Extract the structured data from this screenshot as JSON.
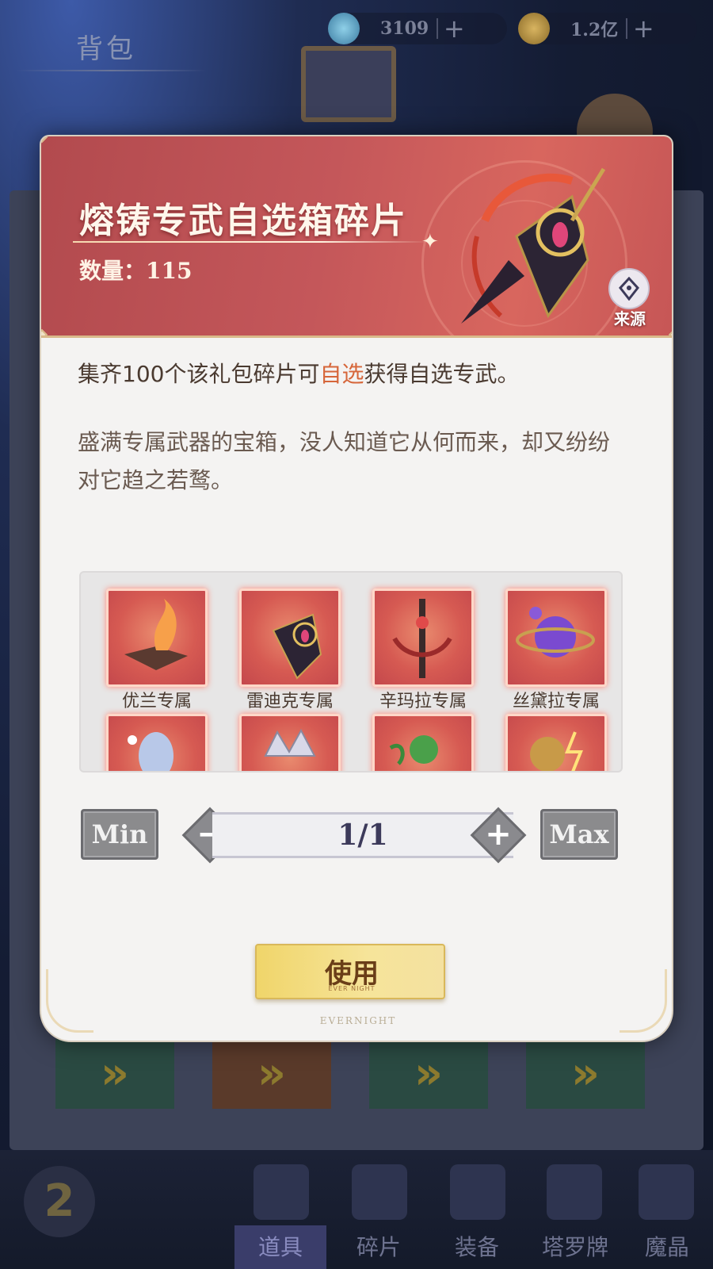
{
  "background": {
    "screen_title": "背包",
    "resources": [
      {
        "icon": "gem-icon",
        "value": "3109",
        "plus": "+"
      },
      {
        "icon": "gold-coin-icon",
        "value": "1.2亿",
        "plus": "+"
      }
    ],
    "nav_tabs": [
      {
        "label": "道具",
        "active": true
      },
      {
        "label": "碎片",
        "active": false
      },
      {
        "label": "装备",
        "active": false
      },
      {
        "label": "塔罗牌",
        "active": false
      },
      {
        "label": "魔晶",
        "active": false
      }
    ]
  },
  "item": {
    "title": "熔铸专武自选箱碎片",
    "quantity_label": "数量：",
    "quantity_value": "115",
    "source_label": "来源",
    "desc_prefix": "集齐100个该礼包碎片可",
    "desc_highlight": "自选",
    "desc_suffix": "获得自选专武。",
    "flavor_text": "盛满专属武器的宝箱，没人知道它从何而来，却又纷纷对它趋之若鹜。"
  },
  "rewards": [
    {
      "label": "优兰专属",
      "icon": "flaming-book-icon"
    },
    {
      "label": "雷迪克专属",
      "icon": "dark-scythe-icon"
    },
    {
      "label": "辛玛拉专属",
      "icon": "crimson-staff-icon"
    },
    {
      "label": "丝黛拉专属",
      "icon": "purple-orb-icon"
    },
    {
      "label": "",
      "icon": "spirit-beast-icon"
    },
    {
      "label": "",
      "icon": "crystal-crown-icon"
    },
    {
      "label": "",
      "icon": "green-orb-icon"
    },
    {
      "label": "",
      "icon": "lightning-lantern-icon"
    }
  ],
  "stepper": {
    "min_label": "Min",
    "max_label": "Max",
    "value": "1/1",
    "minus_symbol": "−",
    "plus_symbol": "+"
  },
  "use_button": {
    "label": "使用",
    "sub_label": "EVER NIGHT"
  },
  "footer_brand": "EVERNIGHT",
  "colors": {
    "banner": "#c4575a",
    "highlight": "#d6663a",
    "use_button": "#f0d56a"
  }
}
